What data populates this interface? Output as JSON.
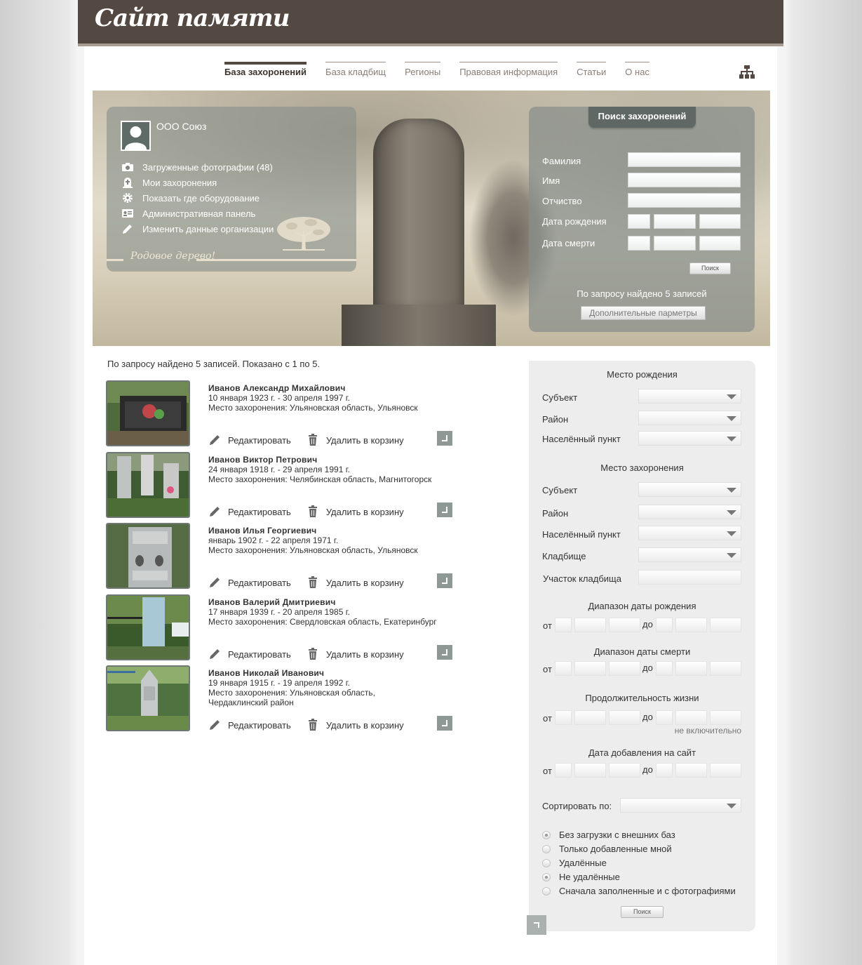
{
  "site": {
    "title": "Сайт памяти"
  },
  "nav": [
    {
      "label": "База захоронений",
      "active": true
    },
    {
      "label": "База кладбищ",
      "active": false
    },
    {
      "label": "Регионы",
      "active": false
    },
    {
      "label": "Правовая информация",
      "active": false
    },
    {
      "label": "Статьи",
      "active": false
    },
    {
      "label": "О нас",
      "active": false
    }
  ],
  "profile": {
    "org_name": "ООО Союз",
    "menu": [
      {
        "icon": "camera-icon",
        "label": "Загруженные фотографии (48)"
      },
      {
        "icon": "grave-icon",
        "label": "Мои захоронения"
      },
      {
        "icon": "gear-icon",
        "label": "Показать где оборудование"
      },
      {
        "icon": "id-card-icon",
        "label": "Административная панель"
      },
      {
        "icon": "pencil-icon",
        "label": "Изменить данные организации"
      }
    ],
    "family_tree": "Родовое дерево!"
  },
  "search": {
    "title": "Поиск захоронений",
    "fields": {
      "lastname": "Фамилия",
      "firstname": "Имя",
      "patronymic": "Отчиство",
      "birth_date": "Дата рождения",
      "death_date": "Дата смерти"
    },
    "button": "Поиск",
    "found": "По запросу найдено 5 записей",
    "more": "Дополнительные парметры"
  },
  "results": {
    "summary": "По запросу найдено 5 записей.  Показано с 1 по 5.",
    "edit_label": "Редактировать",
    "delete_label": "Удалить в корзину",
    "items": [
      {
        "name": "Иванов Александр Михайлович",
        "dates": "10 января 1923 г. - 30 апреля 1997 г.",
        "place": "Место захоронения: Ульяновская область, Ульяновск",
        "place2": ""
      },
      {
        "name": "Иванов Виктор Петрович",
        "dates": "24 января 1918 г. - 29 апреля 1991 г.",
        "place": "Место захоронения: Челябинская область, Магнитогорск",
        "place2": ""
      },
      {
        "name": "Иванов Илья Георгиевич",
        "dates": "январь 1902 г. - 22 апреля 1971 г.",
        "place": "Место захоронения: Ульяновская область, Ульяновск",
        "place2": ""
      },
      {
        "name": "Иванов Валерий Дмитриевич",
        "dates": "17 января 1939 г. - 20 апреля 1985 г.",
        "place": "Место захоронения: Свердловская область, Екатеринбург",
        "place2": ""
      },
      {
        "name": "Иванов Николай Иванович",
        "dates": "19 января 1915 г. - 19 апреля 1992 г.",
        "place": "Место захоронения: Ульяновская область,",
        "place2": "Чердаклинский район"
      }
    ]
  },
  "filter": {
    "birth_place": {
      "title": "Место рождения",
      "subject": "Субъект",
      "district": "Район",
      "locality": "Населённый пункт"
    },
    "burial_place": {
      "title": "Место захоронения",
      "subject": "Субъект",
      "district": "Район",
      "locality": "Населённый пункт",
      "cemetery": "Кладбище",
      "plot": "Участок кладбища"
    },
    "from": "от",
    "to": "до",
    "birth_range": "Диапазон даты рождения",
    "death_range": "Диапазон даты смерти",
    "lifespan": "Продолжительность жизни",
    "not_inclusive": "не включительно",
    "added_date": "Дата добавления на сайт",
    "sort_by": "Сортировать по:",
    "options": [
      {
        "label": "Без загрузки с внешних баз",
        "checked": true
      },
      {
        "label": "Только добавленные мной",
        "checked": false
      },
      {
        "label": "Удалённые",
        "checked": false
      },
      {
        "label": "Не удалённые",
        "checked": true
      },
      {
        "label": "Сначала заполненные и с фотографиями",
        "checked": false
      }
    ],
    "button": "Поиск"
  }
}
